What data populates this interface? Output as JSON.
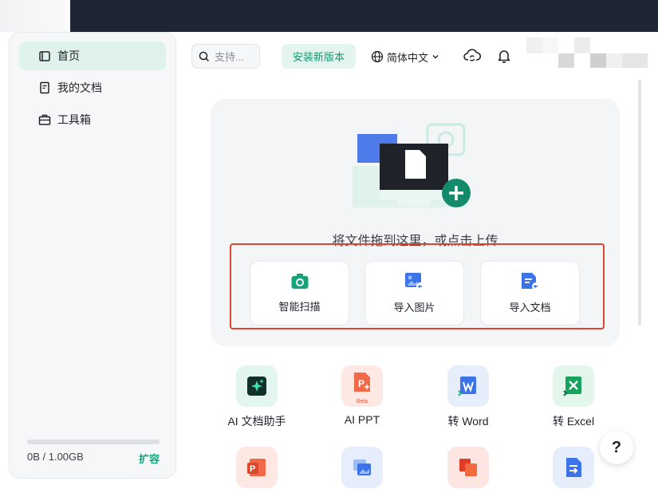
{
  "sidebar": {
    "items": [
      {
        "label": "首页",
        "icon": "home-icon"
      },
      {
        "label": "我的文档",
        "icon": "document-icon"
      },
      {
        "label": "工具箱",
        "icon": "toolbox-icon"
      }
    ],
    "storage": {
      "text": "0B / 1.00GB",
      "used_fraction": 0.0
    },
    "expand_label": "扩容"
  },
  "header": {
    "search_placeholder": "支持...",
    "install_label": "安装新版本",
    "language": "简体中文",
    "icons": [
      "cloud-sync-icon",
      "bell-icon"
    ]
  },
  "upload": {
    "hint": "将文件拖到这里，或点击上传",
    "actions": [
      {
        "label": "智能扫描",
        "icon": "camera-scan-icon"
      },
      {
        "label": "导入图片",
        "icon": "import-image-icon"
      },
      {
        "label": "导入文档",
        "icon": "import-document-icon"
      }
    ]
  },
  "tools": [
    {
      "label": "AI 文档助手",
      "icon": "ai-assistant-icon"
    },
    {
      "label": "AI PPT",
      "icon": "ai-ppt-icon",
      "badge": "Beta"
    },
    {
      "label": "转 Word",
      "icon": "convert-word-icon"
    },
    {
      "label": "转 Excel",
      "icon": "convert-excel-icon"
    },
    {
      "label": "",
      "icon": "ppt-icon"
    },
    {
      "label": "",
      "icon": "image-convert-icon"
    },
    {
      "label": "",
      "icon": "pdf-tools-icon"
    },
    {
      "label": "",
      "icon": "doc-convert-icon"
    }
  ],
  "help_label": "?",
  "colors": {
    "accent": "#17a37d",
    "highlight": "#e0452f",
    "dark_bar": "#1e2533"
  }
}
